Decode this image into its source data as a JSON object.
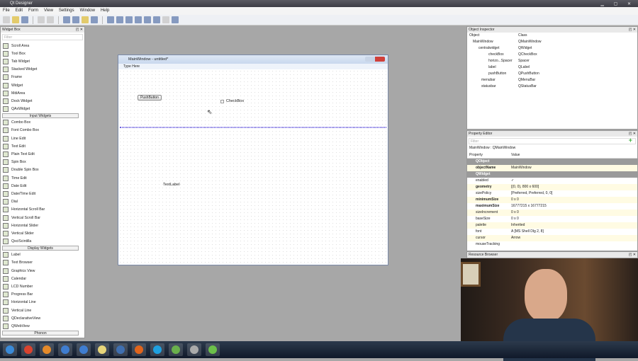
{
  "app": {
    "title": "Qt Designer"
  },
  "menu": [
    "File",
    "Edit",
    "Form",
    "View",
    "Settings",
    "Window",
    "Help"
  ],
  "widget_box": {
    "title": "Widget Box",
    "filter_placeholder": "Filter",
    "items_containers": [
      "Scroll Area",
      "Tool Box",
      "Tab Widget",
      "Stacked Widget",
      "Frame",
      "Widget",
      "MdiArea",
      "Dock Widget",
      "QAxWidget"
    ],
    "cat_input": "Input Widgets",
    "items_input": [
      "Combo Box",
      "Font Combo Box",
      "Line Edit",
      "Text Edit",
      "Plain Text Edit",
      "Spin Box",
      "Double Spin Box",
      "Time Edit",
      "Date Edit",
      "Date/Time Edit",
      "Dial",
      "Horizontal Scroll Bar",
      "Vertical Scroll Bar",
      "Horizontal Slider",
      "Vertical Slider",
      "QsciScintilla"
    ],
    "cat_display": "Display Widgets",
    "items_display": [
      "Label",
      "Text Browser",
      "Graphics View",
      "Calendar",
      "LCD Number",
      "Progress Bar",
      "Horizontal Line",
      "Vertical Line",
      "QDeclarativeView",
      "QWebView"
    ],
    "cat_phonon": "Phonon"
  },
  "form": {
    "title": "MainWindow - untitled*",
    "menu_placeholder": "Type Here",
    "push_button": "PushButton",
    "checkbox": "CheckBox",
    "label": "TextLabel"
  },
  "object_inspector": {
    "title": "Object Inspector",
    "col_object": "Object",
    "col_class": "Class",
    "rows": [
      [
        "MainWindow",
        "QMainWindow"
      ],
      [
        "centralwidget",
        "QWidget"
      ],
      [
        "checkBox",
        "QCheckBox"
      ],
      [
        "horizo...Spacer",
        "Spacer"
      ],
      [
        "label",
        "QLabel"
      ],
      [
        "pushButton",
        "QPushButton"
      ],
      [
        "menubar",
        "QMenuBar"
      ],
      [
        "statusbar",
        "QStatusBar"
      ]
    ]
  },
  "property_editor": {
    "title": "Property Editor",
    "filter_placeholder": "Filter",
    "context": "MainWindow : QMainWindow",
    "col_property": "Property",
    "col_value": "Value",
    "group_qobject": "QObject",
    "group_qwidget": "QWidget",
    "rows": [
      [
        "objectName",
        "MainWindow"
      ],
      [
        "enabled",
        "✓"
      ],
      [
        "geometry",
        "[(0, 0), 800 x 600]"
      ],
      [
        "sizePolicy",
        "[Preferred, Preferred, 0, 0]"
      ],
      [
        "minimumSize",
        "0 x 0"
      ],
      [
        "maximumSize",
        "16777215 x 16777215"
      ],
      [
        "sizeIncrement",
        "0 x 0"
      ],
      [
        "baseSize",
        "0 x 0"
      ],
      [
        "palette",
        "Inherited"
      ],
      [
        "font",
        "A  [MS Shell Dlg 2, 8]"
      ],
      [
        "cursor",
        "Arrow"
      ],
      [
        "mouseTracking",
        ""
      ]
    ]
  },
  "resource_browser": {
    "title": "Resource Browser"
  },
  "taskbar_colors": [
    "#3a8ad8",
    "#d9432f",
    "#e58a2a",
    "#3f7dd0",
    "#3f7dd0",
    "#e7d57a",
    "#3f6fb0",
    "#e0641c",
    "#1ea0e0",
    "#6ab04c",
    "#aaaaaa",
    "#6cc04a"
  ]
}
